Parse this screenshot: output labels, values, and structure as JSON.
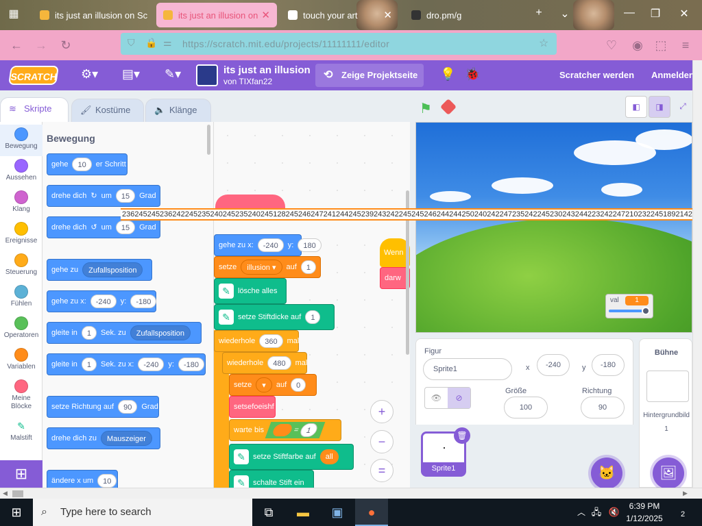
{
  "browser": {
    "tabs": [
      {
        "title": "its just an illusion on Sc",
        "active": false
      },
      {
        "title": "its just an illusion on Sc",
        "active": true
      },
      {
        "title": "touch your art",
        "active": false
      },
      {
        "title": "dro.pm/g",
        "active": false
      }
    ],
    "new_tab": "+",
    "dropdown": "⌄",
    "min": "—",
    "max": "❐",
    "close": "✕",
    "url": "https://scratch.mit.edu/projects/11111111/editor"
  },
  "menu": {
    "logo": "SCRATCH",
    "project_title": "its just an illusion",
    "project_author": "von TIXfan22",
    "see_project": "Zeige Projektseite",
    "join": "Scratcher werden",
    "login": "Anmelden"
  },
  "tabs": {
    "code": "Skripte",
    "costumes": "Kostüme",
    "sounds": "Klänge"
  },
  "categories": [
    {
      "label": "Bewegung",
      "color": "#4c97ff"
    },
    {
      "label": "Aussehen",
      "color": "#9966ff"
    },
    {
      "label": "Klang",
      "color": "#cf63cf"
    },
    {
      "label": "Ereignisse",
      "color": "#ffbf00"
    },
    {
      "label": "Steuerung",
      "color": "#ffab19"
    },
    {
      "label": "Fühlen",
      "color": "#5cb1d6"
    },
    {
      "label": "Operatoren",
      "color": "#59c059"
    },
    {
      "label": "Variablen",
      "color": "#ff8c1a"
    },
    {
      "label": "Meine Blöcke",
      "color": "#ff6680"
    },
    {
      "label": "Malstift",
      "color": "#0fbd8c"
    }
  ],
  "palette": {
    "heading": "Bewegung",
    "blocks": {
      "move": {
        "pre": "gehe",
        "val": "10",
        "post": "er Schritt"
      },
      "turn_right": {
        "pre": "drehe dich",
        "icon": "↻",
        "mid": "um",
        "val": "15",
        "post": "Grad"
      },
      "turn_left": {
        "pre": "drehe dich",
        "icon": "↺",
        "mid": "um",
        "val": "15",
        "post": "Grad"
      },
      "goto": {
        "pre": "gehe zu",
        "dd": "Zufallsposition"
      },
      "gotoxy": {
        "pre": "gehe zu x:",
        "x": "-240",
        "ylabel": "y:",
        "y": "-180"
      },
      "glide": {
        "pre": "gleite in",
        "val": "1",
        "mid": "Sek. zu",
        "dd": "Zufallsposition"
      },
      "glidexy": {
        "pre": "gleite in",
        "val": "1",
        "mid": "Sek. zu x:",
        "x": "-240",
        "ylabel": "y:",
        "y": "-180"
      },
      "point": {
        "pre": "setze Richtung auf",
        "val": "90",
        "post": "Grad"
      },
      "pointtowards": {
        "pre": "drehe dich zu",
        "dd": "Mauszeiger"
      },
      "changex": {
        "pre": "ändere x um",
        "val": "10"
      }
    }
  },
  "overlay_numbers": "2362452452362422452352402452352402451282452462472412442452392432422452452462442442502402422472352422452302432442232422472102322451892142",
  "script": {
    "gotoxy": {
      "pre": "gehe zu x:",
      "x": "-240",
      "ylabel": "y:",
      "y": "180"
    },
    "set_var": {
      "pre": "setze",
      "dd": "illusion ▾",
      "mid": "auf",
      "val": "1"
    },
    "clear": "lösche alles",
    "pen_size": {
      "pre": "setze Stiftdicke auf",
      "val": "1"
    },
    "repeat1": {
      "pre": "wiederhole",
      "val": "360",
      "post": "mal"
    },
    "repeat2": {
      "pre": "wiederhole",
      "val": "480",
      "post": "mal"
    },
    "set_var2": {
      "pre": "setze",
      "dd": "▾",
      "mid": "auf",
      "val": "0"
    },
    "custom": "setsefoeishf",
    "wait_until": {
      "pre": "warte bis",
      "eq": "=",
      "val": "1"
    },
    "pen_color": {
      "pre": "setze Stiftfarbe auf",
      "val": "all"
    },
    "pen_down": "schalte Stift ein",
    "hat1": "Wenn",
    "hat2": "darw",
    "zoom_in": "+",
    "zoom_out": "−",
    "zoom_reset": "="
  },
  "monitor": {
    "label": "val",
    "value": "1"
  },
  "sprite": {
    "section": "Figur",
    "name": "Sprite1",
    "x_label": "x",
    "x": "-240",
    "y_label": "y",
    "y": "-180",
    "size_label": "Größe",
    "size": "100",
    "direction_label": "Richtung",
    "direction": "90",
    "tile_name": "Sprite1"
  },
  "stage_panel": {
    "title": "Bühne",
    "backdrops_label": "Hintergrundbild",
    "backdrops_count": "1"
  },
  "taskbar": {
    "search_placeholder": "Type here to search",
    "time": "6:39 PM",
    "date": "1/12/2025",
    "notifications": "2"
  }
}
